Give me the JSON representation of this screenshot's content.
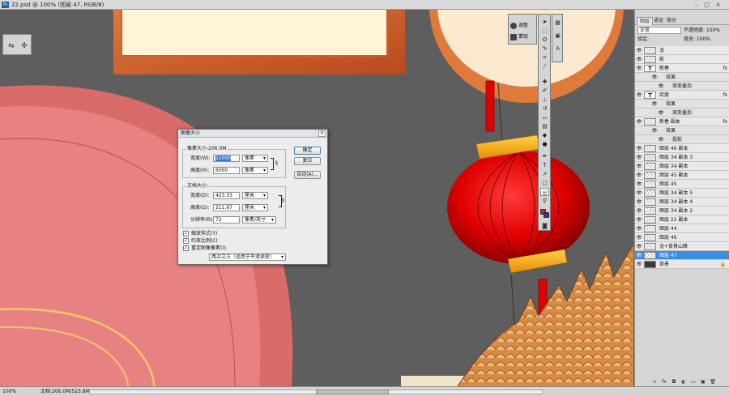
{
  "document": {
    "title": "22.psd @ 100% (图层 47, RGB/8)"
  },
  "adjust_panel": {
    "items": [
      "调整",
      "蒙版"
    ]
  },
  "layers_panel": {
    "tabs": [
      "图层",
      "通道",
      "路径"
    ],
    "blend_mode": "正常",
    "opacity_label": "不透明度: 100%",
    "lock_label": "锁定:",
    "fill_label": "填充: 100%",
    "layers": [
      {
        "name": "龙",
        "thumb": "checker",
        "kind": "layer"
      },
      {
        "name": "影",
        "thumb": "checker",
        "kind": "layer"
      },
      {
        "name": "新春",
        "thumb": "text",
        "kind": "layer",
        "fx": "fx"
      },
      {
        "name": "效果",
        "kind": "sub"
      },
      {
        "name": "渐变叠加",
        "kind": "sub2"
      },
      {
        "name": "欢度",
        "thumb": "text",
        "kind": "layer",
        "fx": "fx"
      },
      {
        "name": "效果",
        "kind": "sub"
      },
      {
        "name": "渐变叠加",
        "kind": "sub2"
      },
      {
        "name": "新春 副本",
        "thumb": "checker",
        "kind": "layer",
        "fx": "fx"
      },
      {
        "name": "效果",
        "kind": "sub"
      },
      {
        "name": "投影",
        "kind": "sub2"
      },
      {
        "name": "图层 46 副本",
        "thumb": "checker",
        "kind": "layer"
      },
      {
        "name": "图层 34 副本 3",
        "thumb": "checker",
        "kind": "layer"
      },
      {
        "name": "图层 34 副本",
        "thumb": "checker",
        "kind": "layer"
      },
      {
        "name": "图层 45 副本",
        "thumb": "checker",
        "kind": "layer"
      },
      {
        "name": "图层 45",
        "thumb": "checker",
        "kind": "layer"
      },
      {
        "name": "图层 34 副本 5",
        "thumb": "checker",
        "kind": "layer"
      },
      {
        "name": "图层 34 副本 4",
        "thumb": "checker",
        "kind": "layer"
      },
      {
        "name": "图层 34 副本 2",
        "thumb": "checker",
        "kind": "layer"
      },
      {
        "name": "图层 22 副本",
        "thumb": "checker",
        "kind": "layer"
      },
      {
        "name": "图层 44",
        "thumb": "checker",
        "kind": "layer"
      },
      {
        "name": "图层 46",
        "thumb": "checker",
        "kind": "layer"
      },
      {
        "name": "龙+背景山峰",
        "thumb": "checker",
        "kind": "layer"
      },
      {
        "name": "图层 47",
        "thumb": "checker",
        "kind": "layer",
        "selected": true
      },
      {
        "name": "背景",
        "thumb": "dark",
        "kind": "layer",
        "locked": true
      }
    ],
    "footer_icons": [
      "link-icon",
      "fx-icon",
      "mask-icon",
      "adjustment-icon",
      "group-icon",
      "new-layer-icon",
      "trash-icon"
    ]
  },
  "dialog": {
    "title": "图像大小",
    "pixel_dimensions": "像素大小:206.0M",
    "width_label": "宽度(W):",
    "width_value": "12000",
    "width_unit": "像素",
    "height_label": "高度(H):",
    "height_value": "6000",
    "height_unit": "像素",
    "document_size": "文档大小:",
    "doc_width_label": "宽度(D):",
    "doc_width_value": "423.33",
    "doc_width_unit": "厘米",
    "doc_height_label": "高度(G):",
    "doc_height_value": "211.67",
    "doc_height_unit": "厘米",
    "resolution_label": "分辨率(R):",
    "resolution_value": "72",
    "resolution_unit": "像素/英寸",
    "ok": "确定",
    "reset": "复位",
    "auto": "自动(A)...",
    "scale_styles": "缩放样式(Y)",
    "constrain": "约束比例(C)",
    "resample": "重定图像像素(I):",
    "resample_method": "两次立方（适用于平滑渐变）"
  },
  "status": {
    "zoom": "100%",
    "doc_size": "文档:206.0M/523.8M"
  }
}
